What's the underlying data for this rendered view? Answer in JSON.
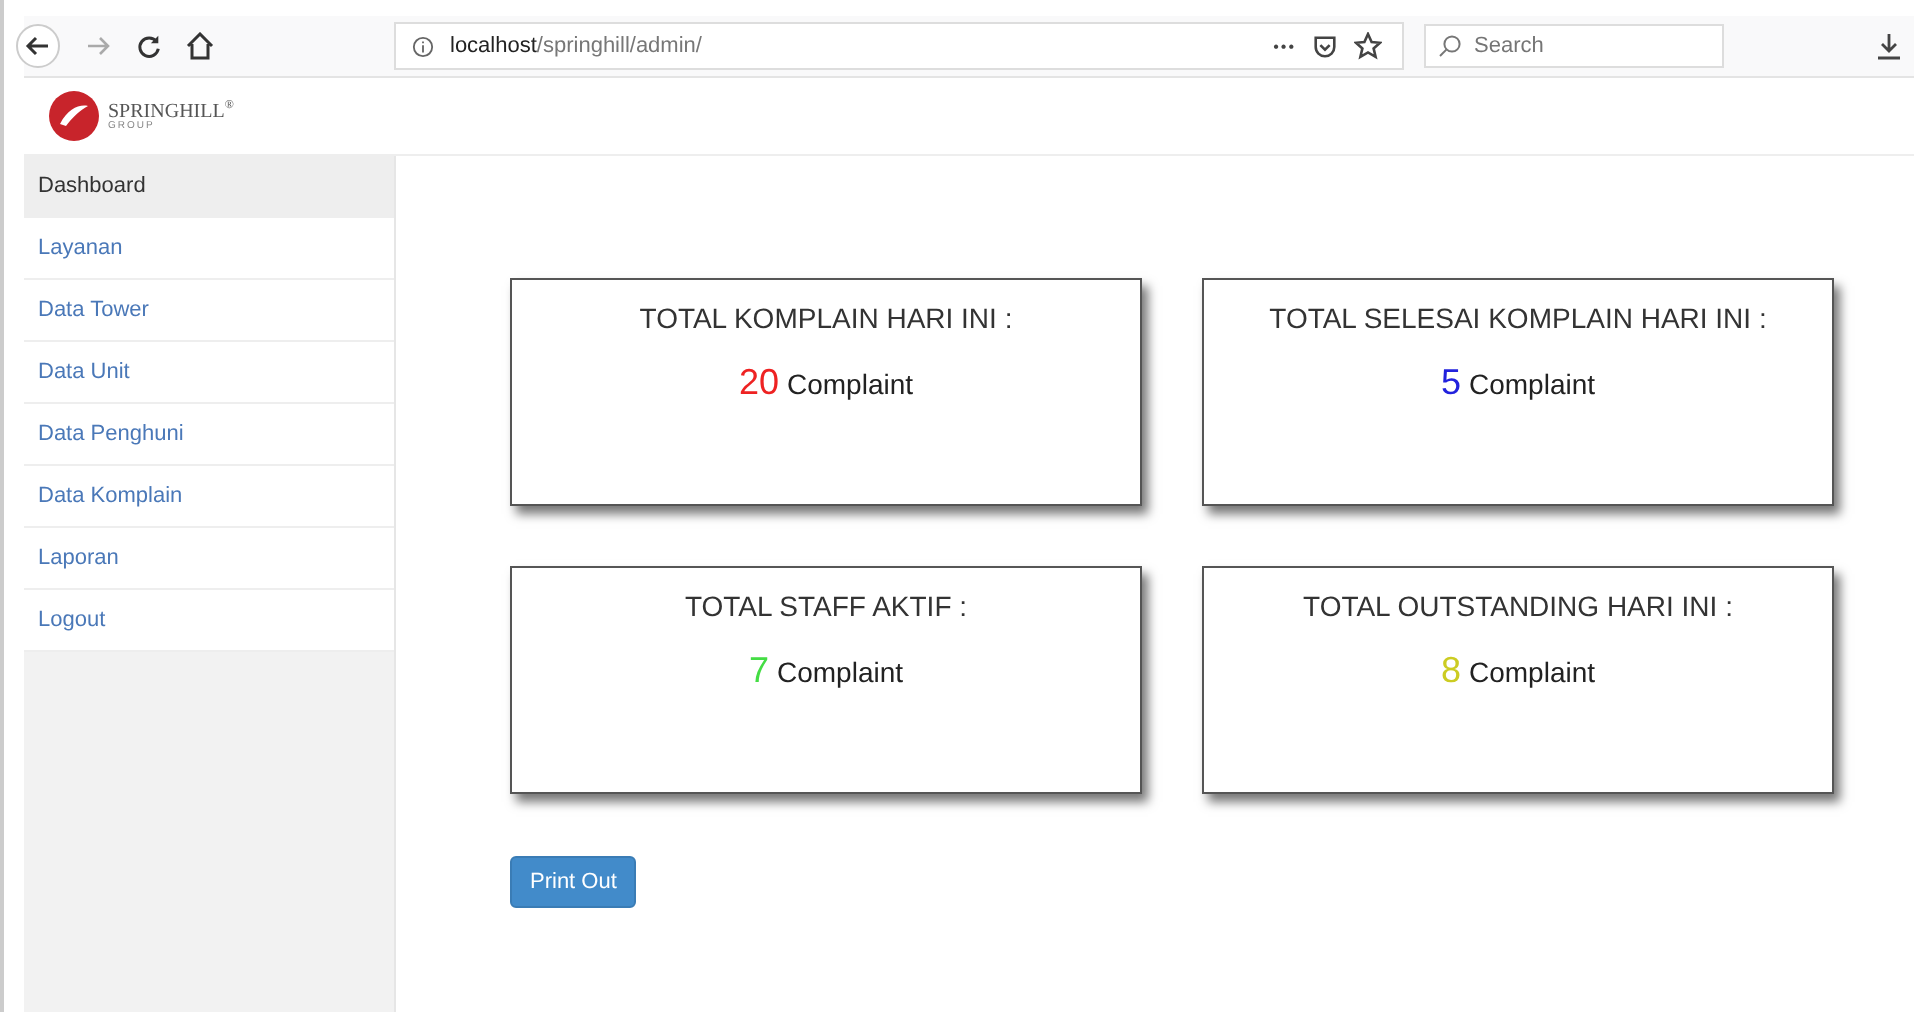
{
  "browser": {
    "url_host": "localhost",
    "url_path": "/springhill/admin/",
    "search_placeholder": "Search",
    "menu_dots": "•••"
  },
  "logo": {
    "name": "SPRINGHILL",
    "mark": "®",
    "sub": "GROUP"
  },
  "sidebar": {
    "items": [
      {
        "label": "Dashboard",
        "selected": true
      },
      {
        "label": "Layanan",
        "selected": false
      },
      {
        "label": "Data Tower",
        "selected": false
      },
      {
        "label": "Data Unit",
        "selected": false
      },
      {
        "label": "Data Penghuni",
        "selected": false
      },
      {
        "label": "Data Komplain",
        "selected": false
      },
      {
        "label": "Laporan",
        "selected": false
      },
      {
        "label": "Logout",
        "selected": false
      }
    ]
  },
  "cards": [
    {
      "title": "TOTAL KOMPLAIN HARI INI :",
      "count": "20",
      "unit": "Complaint",
      "color": "#ee2222"
    },
    {
      "title": "TOTAL SELESAI KOMPLAIN HARI INI :",
      "count": "5",
      "unit": "Complaint",
      "color": "#2222dd"
    },
    {
      "title": "TOTAL STAFF AKTIF :",
      "count": "7",
      "unit": "Complaint",
      "color": "#44dd44"
    },
    {
      "title": "TOTAL OUTSTANDING HARI INI :",
      "count": "8",
      "unit": "Complaint",
      "color": "#cccc22"
    }
  ],
  "print_button": "Print Out"
}
